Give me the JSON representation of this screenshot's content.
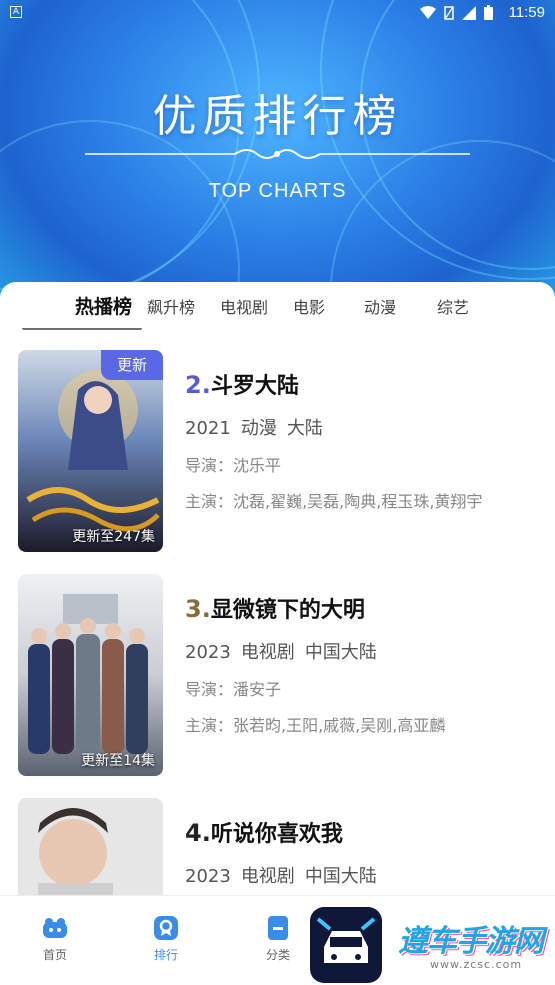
{
  "status_bar": {
    "left_icon": "A",
    "time": "11:59",
    "icons": [
      "wifi-icon",
      "battery-saver-icon",
      "signal-icon",
      "battery-icon"
    ]
  },
  "header": {
    "title": "优质排行榜",
    "subtitle": "TOP CHARTS"
  },
  "tabs": [
    {
      "label": "热播榜",
      "active": true
    },
    {
      "label": "飙升榜",
      "active": false
    },
    {
      "label": "电视剧",
      "active": false
    },
    {
      "label": "电影",
      "active": false
    },
    {
      "label": "动漫",
      "active": false
    },
    {
      "label": "综艺",
      "active": false
    }
  ],
  "items": [
    {
      "rank": "2.",
      "rank_color": "#5b5bd6",
      "title": "斗罗大陆",
      "year": "2021",
      "genre": "动漫",
      "region": "大陆",
      "director": "导演：沈乐平",
      "cast": "主演：沈磊,翟巍,吴磊,陶典,程玉珠,黄翔宇",
      "badge": "更新",
      "episodes": "更新至247集"
    },
    {
      "rank": "3.",
      "rank_color": "#8a6a3a",
      "title": "显微镜下的大明",
      "year": "2023",
      "genre": "电视剧",
      "region": "中国大陆",
      "director": "导演：潘安子",
      "cast": "主演：张若昀,王阳,戚薇,吴刚,高亚麟",
      "episodes": "更新至14集"
    },
    {
      "rank": "4.",
      "rank_color": "#222222",
      "title": "听说你喜欢我",
      "year": "2023",
      "genre": "电视剧",
      "region": "中国大陆"
    }
  ],
  "nav": [
    {
      "label": "首页",
      "icon": "home-icon",
      "active": false
    },
    {
      "label": "排行",
      "icon": "ranking-icon",
      "active": true
    },
    {
      "label": "分类",
      "icon": "category-icon",
      "active": false
    }
  ],
  "watermark": {
    "text": "遵车手游网",
    "url": "www.zcsc.com"
  },
  "colors": {
    "accent": "#3a8de6",
    "badge": "#5a68e6"
  }
}
